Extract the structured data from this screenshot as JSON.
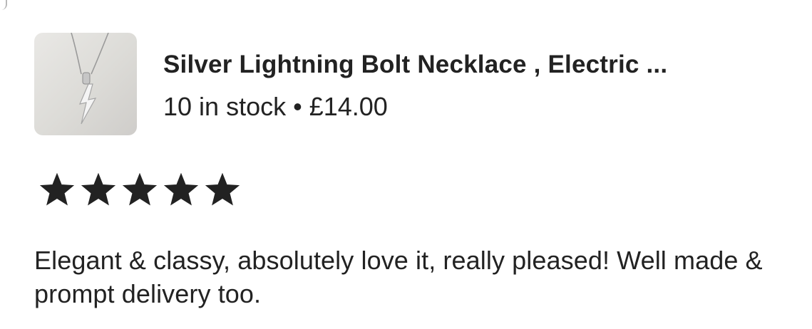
{
  "product": {
    "title": "Silver Lightning Bolt Necklace , Electric ...",
    "meta": "10 in stock • £14.00",
    "thumbnail_icon": "necklace-photo"
  },
  "rating": {
    "stars": 5,
    "max": 5,
    "star_icon": "star-icon"
  },
  "review": {
    "text": "Elegant & classy, absolutely love it, really pleased! Well made & prompt delivery too."
  },
  "colors": {
    "text": "#222222",
    "star": "#222222",
    "background": "#ffffff"
  }
}
